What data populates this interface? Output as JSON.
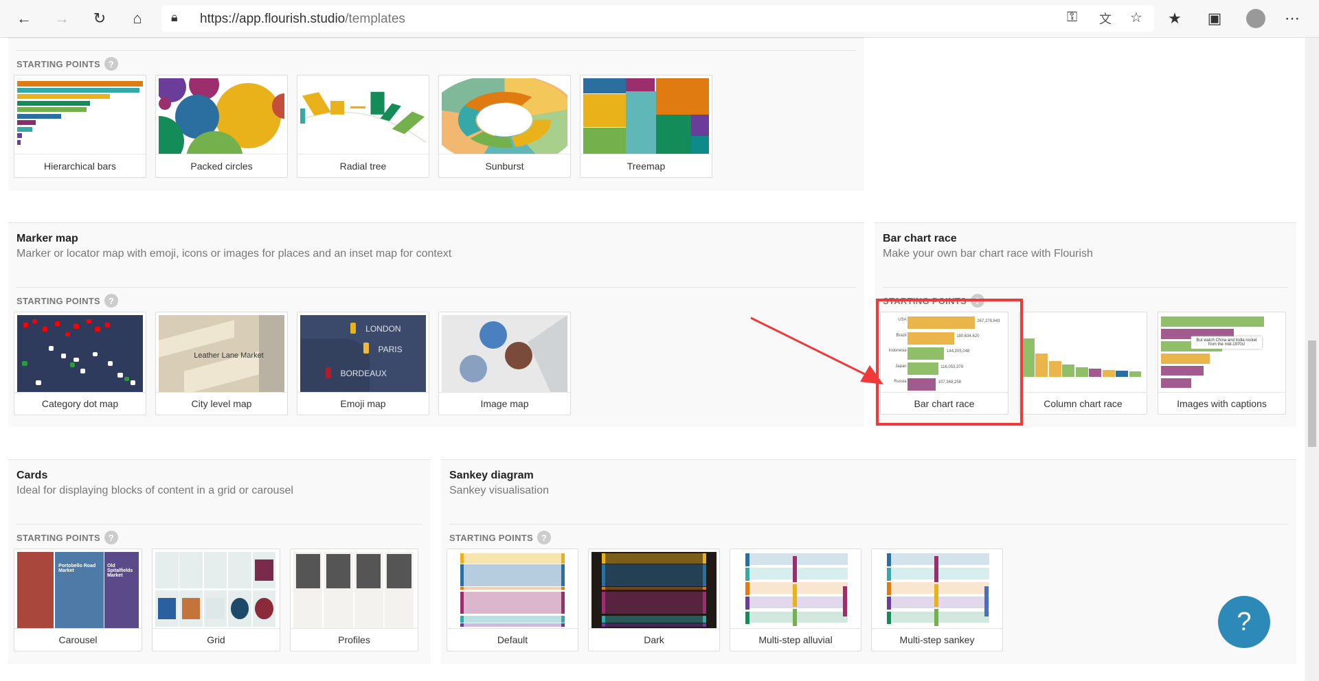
{
  "browser": {
    "url_host": "https://app.flourish.studio",
    "url_path": "/templates",
    "icons": [
      "back-icon",
      "forward-icon",
      "refresh-icon",
      "home-icon",
      "lock-icon",
      "key-icon",
      "translate-icon",
      "star-icon",
      "favorites-icon",
      "collections-icon",
      "profile-avatar",
      "more-icon"
    ]
  },
  "starting_points_label": "STARTING POINTS",
  "help_glyph": "?",
  "colors": {
    "accent": "#2d8ab8",
    "highlight": "#f03a3a"
  },
  "sections": [
    {
      "id": "hierarchy",
      "title": "",
      "subtitle": "",
      "cards": [
        {
          "label": "Hierarchical bars",
          "thumb": "hbars"
        },
        {
          "label": "Packed circles",
          "thumb": "circles"
        },
        {
          "label": "Radial tree",
          "thumb": "radial"
        },
        {
          "label": "Sunburst",
          "thumb": "sunburst"
        },
        {
          "label": "Treemap",
          "thumb": "treemap"
        }
      ]
    },
    {
      "id": "marker-map",
      "title": "Marker map",
      "subtitle": "Marker or locator map with emoji, icons or images for places and an inset map for context",
      "cards": [
        {
          "label": "Category dot map",
          "thumb": "dotmap"
        },
        {
          "label": "City level map",
          "thumb": "citymap",
          "text": "Leather Lane Market"
        },
        {
          "label": "Emoji map",
          "thumb": "emojimap",
          "places": [
            "LONDON",
            "PARIS",
            "BORDEAUX"
          ]
        },
        {
          "label": "Image map",
          "thumb": "imagemap"
        }
      ]
    },
    {
      "id": "bar-chart-race",
      "title": "Bar chart race",
      "subtitle": "Make your own bar chart race with Flourish",
      "cards": [
        {
          "label": "Bar chart race",
          "thumb": "barrace",
          "rows": [
            [
              "USA",
              "267,278,643"
            ],
            [
              "Brazil",
              "180,634,620"
            ],
            [
              "Indonesia",
              "144,205,048"
            ],
            [
              "Japan",
              "116,053,379"
            ],
            [
              "Russia",
              "107,348,258"
            ]
          ]
        },
        {
          "label": "Column chart race",
          "thumb": "colrace"
        },
        {
          "label": "Images with captions",
          "thumb": "imgcap",
          "caption": "But watch China and India rocket from the mid-1970s!"
        }
      ]
    },
    {
      "id": "cards",
      "title": "Cards",
      "subtitle": "Ideal for displaying blocks of content in a grid or carousel",
      "cards": [
        {
          "label": "Carousel",
          "thumb": "carousel",
          "texts": [
            "Portobello Road Market",
            "Old Spitalfields Market"
          ]
        },
        {
          "label": "Grid",
          "thumb": "grid"
        },
        {
          "label": "Profiles",
          "thumb": "profiles"
        }
      ]
    },
    {
      "id": "sankey",
      "title": "Sankey diagram",
      "subtitle": "Sankey visualisation",
      "cards": [
        {
          "label": "Default",
          "thumb": "sankey"
        },
        {
          "label": "Dark",
          "thumb": "sankeydark"
        },
        {
          "label": "Multi-step alluvial",
          "thumb": "alluvial"
        },
        {
          "label": "Multi-step sankey",
          "thumb": "msankey"
        }
      ]
    }
  ]
}
